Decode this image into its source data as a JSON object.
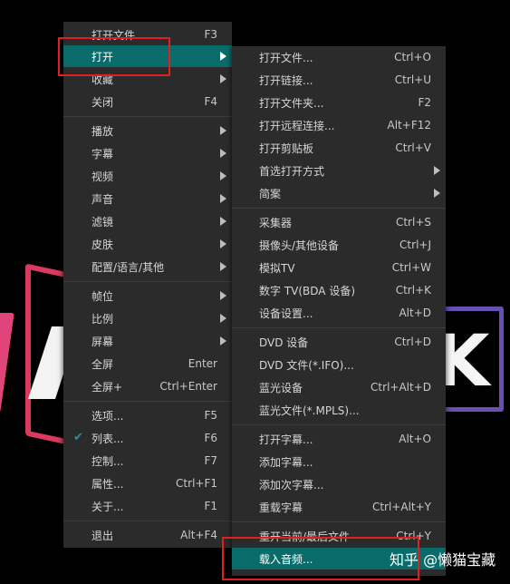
{
  "main_menu": {
    "items": [
      {
        "label": "打开文件",
        "shortcut": "F3"
      },
      {
        "label": "打开",
        "shortcut": "",
        "submenu": true,
        "active": true
      },
      {
        "label": "收藏",
        "shortcut": "",
        "submenu": true
      },
      {
        "label": "关闭",
        "shortcut": "F4"
      },
      {
        "label": "播放",
        "shortcut": "",
        "submenu": true
      },
      {
        "label": "字幕",
        "shortcut": "",
        "submenu": true
      },
      {
        "label": "视频",
        "shortcut": "",
        "submenu": true
      },
      {
        "label": "声音",
        "shortcut": "",
        "submenu": true
      },
      {
        "label": "滤镜",
        "shortcut": "",
        "submenu": true
      },
      {
        "label": "皮肤",
        "shortcut": "",
        "submenu": true
      },
      {
        "label": "配置/语言/其他",
        "shortcut": "",
        "submenu": true
      },
      {
        "label": "帧位",
        "shortcut": "",
        "submenu": true
      },
      {
        "label": "比例",
        "shortcut": "",
        "submenu": true
      },
      {
        "label": "屏幕",
        "shortcut": "",
        "submenu": true
      },
      {
        "label": "全屏",
        "shortcut": "Enter"
      },
      {
        "label": "全屏+",
        "shortcut": "Ctrl+Enter"
      },
      {
        "label": "选项...",
        "shortcut": "F5"
      },
      {
        "label": "列表...",
        "shortcut": "F6",
        "checked": true
      },
      {
        "label": "控制...",
        "shortcut": "F7"
      },
      {
        "label": "属性...",
        "shortcut": "Ctrl+F1"
      },
      {
        "label": "关于...",
        "shortcut": "F1"
      },
      {
        "label": "退出",
        "shortcut": "Alt+F4"
      }
    ]
  },
  "sub_menu": {
    "items": [
      {
        "label": "打开文件...",
        "shortcut": "Ctrl+O"
      },
      {
        "label": "打开链接...",
        "shortcut": "Ctrl+U"
      },
      {
        "label": "打开文件夹...",
        "shortcut": "F2"
      },
      {
        "label": "打开远程连接...",
        "shortcut": "Alt+F12"
      },
      {
        "label": "打开剪贴板",
        "shortcut": "Ctrl+V"
      },
      {
        "label": "首选打开方式",
        "shortcut": "",
        "submenu": true
      },
      {
        "label": "简案",
        "shortcut": "",
        "submenu": true
      },
      {
        "label": "采集器",
        "shortcut": "Ctrl+S"
      },
      {
        "label": "摄像头/其他设备",
        "shortcut": "Ctrl+J"
      },
      {
        "label": "模拟TV",
        "shortcut": "Ctrl+W"
      },
      {
        "label": "数字 TV(BDA 设备)",
        "shortcut": "Ctrl+K"
      },
      {
        "label": "设备设置...",
        "shortcut": "Alt+D"
      },
      {
        "label": "DVD 设备",
        "shortcut": "Ctrl+D"
      },
      {
        "label": "DVD 文件(*.IFO)...",
        "shortcut": ""
      },
      {
        "label": "蓝光设备",
        "shortcut": "Ctrl+Alt+D"
      },
      {
        "label": "蓝光文件(*.MPLS)...",
        "shortcut": ""
      },
      {
        "label": "打开字幕...",
        "shortcut": "Alt+O"
      },
      {
        "label": "添加字幕...",
        "shortcut": ""
      },
      {
        "label": "添加次字幕...",
        "shortcut": ""
      },
      {
        "label": "重载字幕",
        "shortcut": "Ctrl+Alt+Y"
      },
      {
        "label": "重开当前/最后文件",
        "shortcut": "Ctrl+Y"
      },
      {
        "label": "载入音频...",
        "shortcut": "",
        "active": true
      }
    ]
  },
  "watermark": "知乎 @懒猫宝藏",
  "colors": {
    "highlight": "#0a6b6b",
    "annotation": "#e02020",
    "menu_bg": "#2b2b2b"
  }
}
